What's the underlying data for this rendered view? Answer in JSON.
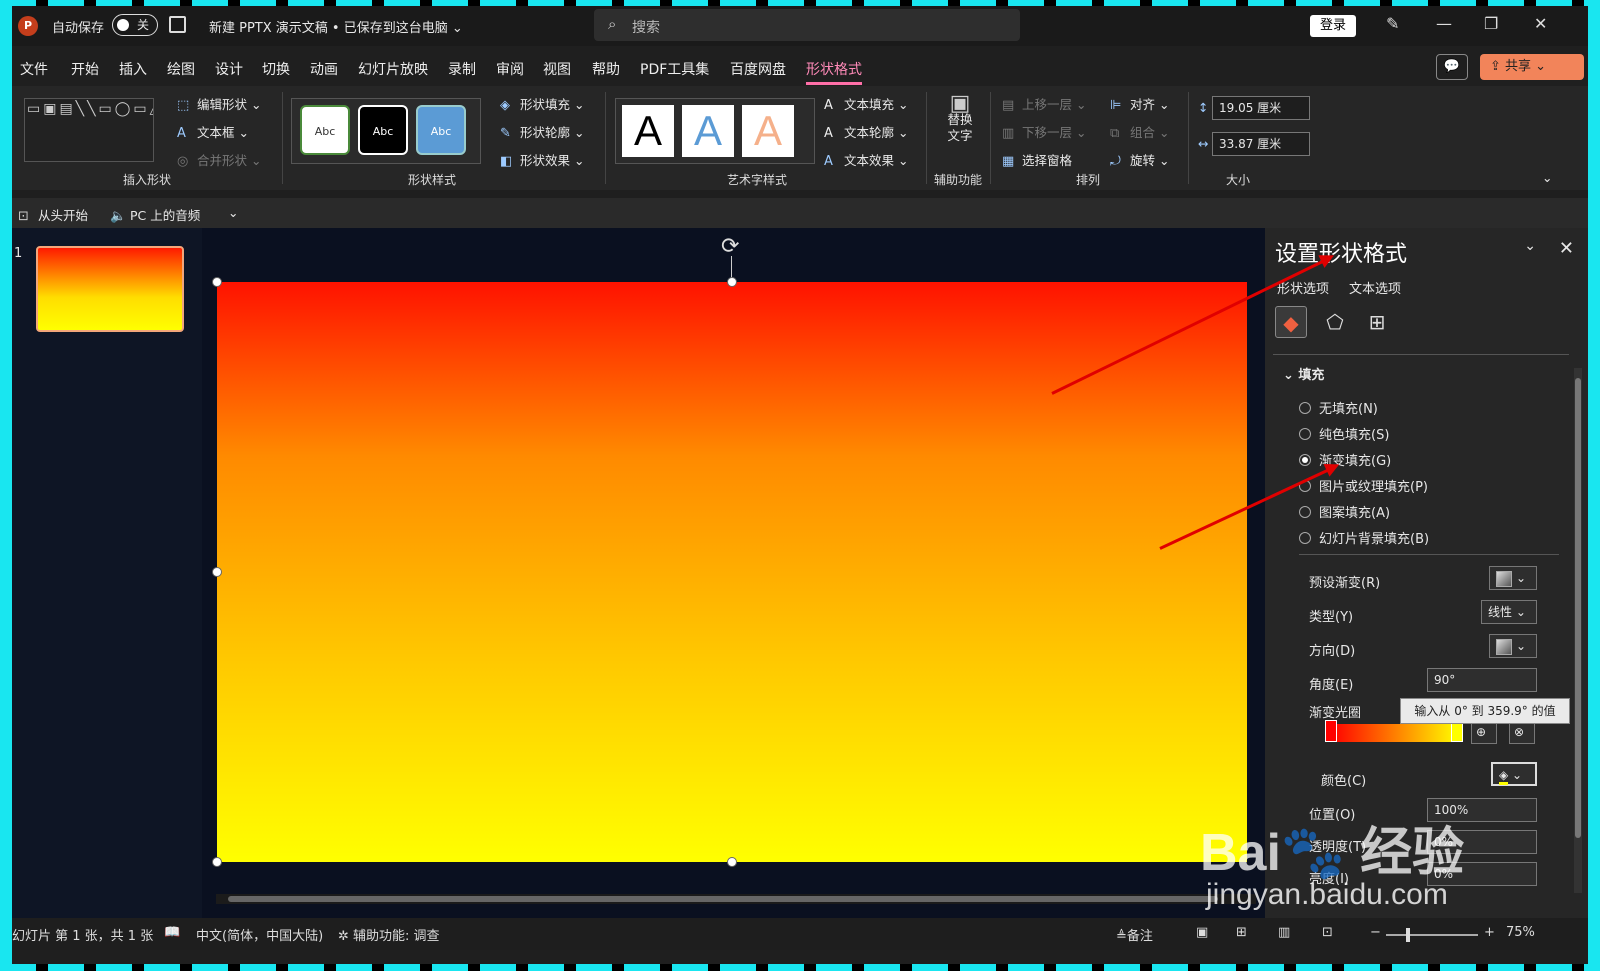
{
  "titlebar": {
    "logo": "P",
    "autosave": "自动保存",
    "toggle": "关",
    "doc_title": "新建 PPTX 演示文稿 • 已保存到这台电脑 ⌄",
    "search_placeholder": "搜索",
    "login": "登录"
  },
  "menu": [
    "文件",
    "开始",
    "插入",
    "绘图",
    "设计",
    "切换",
    "动画",
    "幻灯片放映",
    "录制",
    "审阅",
    "视图",
    "帮助",
    "PDF工具集",
    "百度网盘",
    "形状格式"
  ],
  "share": "共享",
  "ribbon": {
    "insert_shapes": {
      "label": "插入形状",
      "edit_shape": "编辑形状 ⌄",
      "textbox": "文本框 ⌄",
      "merge": "合并形状 ⌄"
    },
    "shape_styles": {
      "label": "形状样式",
      "samples": [
        "Abc",
        "Abc",
        "Abc"
      ],
      "fill": "形状填充 ⌄",
      "outline": "形状轮廓 ⌄",
      "effect": "形状效果 ⌄"
    },
    "wordart": {
      "label": "艺术字样式",
      "samples": [
        "A",
        "A",
        "A"
      ],
      "text_fill": "文本填充 ⌄",
      "text_outline": "文本轮廓 ⌄",
      "text_effect": "文本效果 ⌄"
    },
    "accessibility": {
      "label": "辅助功能",
      "alt_text": "替换文字"
    },
    "arrange": {
      "label": "排列",
      "bring_forward": "上移一层",
      "send_backward": "下移一层",
      "selection_pane": "选择窗格",
      "align": "对齐 ⌄",
      "group": "组合 ⌄",
      "rotate": "旋转 ⌄"
    },
    "size": {
      "label": "大小",
      "height": "19.05 厘米",
      "width": "33.87 厘米"
    }
  },
  "qat": {
    "from_start": "从头开始",
    "audio": "PC 上的音频"
  },
  "slides": {
    "number": "1"
  },
  "pane": {
    "title": "设置形状格式",
    "tabs": [
      "形状选项",
      "文本选项"
    ],
    "section": "填充",
    "fill_options": [
      "无填充(N)",
      "纯色填充(S)",
      "渐变填充(G)",
      "图片或纹理填充(P)",
      "图案填充(A)",
      "幻灯片背景填充(B)"
    ],
    "selected_fill": "渐变填充(G)",
    "preset": "预设渐变(R)",
    "type": "类型(Y)",
    "type_value": "线性",
    "direction": "方向(D)",
    "angle": "角度(E)",
    "angle_value": "90°",
    "stops": "渐变光圈",
    "color": "颜色(C)",
    "position": "位置(O)",
    "position_value": "100%",
    "transparency": "透明度(T)",
    "transparency_value": "0%",
    "brightness": "亮度(I)",
    "brightness_value": "0%",
    "tooltip": "输入从 0° 到 359.9° 的值"
  },
  "status": {
    "slide": "幻灯片 第 1 张，共 1 张",
    "lang": "中文(简体，中国大陆)",
    "access": "辅助功能: 调查",
    "notes": "备注",
    "zoom": "75%"
  },
  "watermark": {
    "line1": "Bai🐾 经验",
    "line2": "jingyan.baidu.com"
  },
  "colors": {
    "accent": "#ff6fa8",
    "share": "#f2845a",
    "gradient_start": "#ff0000",
    "gradient_end": "#ffff00"
  }
}
